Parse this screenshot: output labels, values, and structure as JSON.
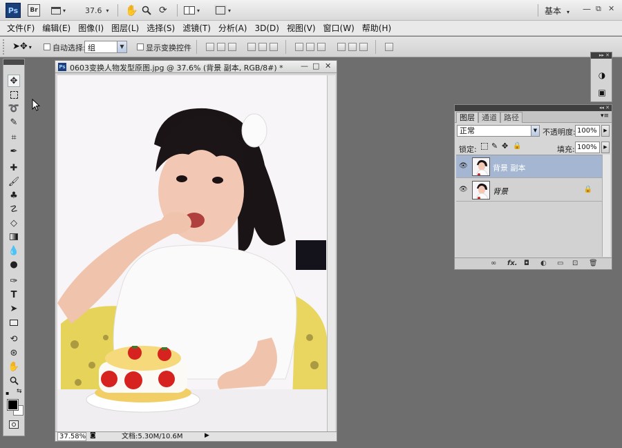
{
  "appbar": {
    "ps_logo": "Ps",
    "br_logo": "Br",
    "zoom_value": "37.6",
    "workspace": "基本",
    "win_minimize": "—",
    "win_restore": "⧉",
    "win_close": "✕"
  },
  "menu": [
    "文件(F)",
    "编辑(E)",
    "图像(I)",
    "图层(L)",
    "选择(S)",
    "滤镜(T)",
    "分析(A)",
    "3D(D)",
    "视图(V)",
    "窗口(W)",
    "帮助(H)"
  ],
  "options": {
    "auto_select_label": "自动选择:",
    "auto_select_value": "组",
    "show_transform_label": "显示变换控件"
  },
  "document": {
    "title": "0603变换人物发型原图.jpg @ 37.6% (背景 副本, RGB/8#) *",
    "zoom_percent": "37.58%",
    "doc_info": "文档:5.30M/10.6M"
  },
  "layers_panel": {
    "tabs": [
      "图层",
      "通道",
      "路径"
    ],
    "blend_mode": "正常",
    "opacity_label": "不透明度:",
    "opacity_value": "100%",
    "lock_label": "锁定:",
    "fill_label": "填充:",
    "fill_value": "100%",
    "layers": [
      {
        "name": "背景 副本",
        "selected": true,
        "locked": false
      },
      {
        "name": "背景",
        "selected": false,
        "locked": true
      }
    ],
    "footer_icons": [
      "link-icon",
      "fx-icon",
      "mask-icon",
      "adjustment-icon",
      "group-icon",
      "new-layer-icon",
      "trash-icon"
    ],
    "footer_fx": "fx."
  },
  "colors": {
    "foreground": "#000000",
    "background": "#ffffff",
    "selected_layer": "#a4b6d2",
    "workspace_bg": "#6e6e6e"
  }
}
